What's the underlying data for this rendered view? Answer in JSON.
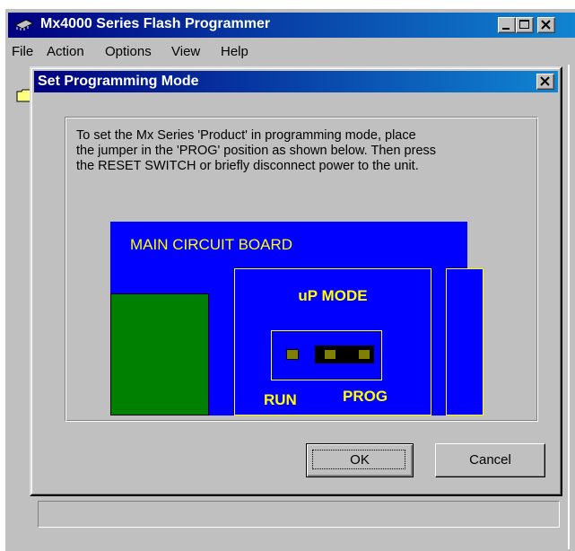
{
  "window": {
    "title": "Mx4000 Series Flash Programmer",
    "icons": {
      "app": "chip-icon",
      "minimize": "minimize-icon",
      "maximize": "maximize-icon",
      "close": "close-icon",
      "folder": "folder-icon"
    }
  },
  "menubar": {
    "items": [
      {
        "label": "File"
      },
      {
        "label": "Action"
      },
      {
        "label": "Options"
      },
      {
        "label": "View"
      },
      {
        "label": "Help"
      }
    ]
  },
  "dialog": {
    "title": "Set Programming Mode",
    "instructions": "To set the Mx Series 'Product' in programming mode, place\nthe jumper in the 'PROG' position as shown below. Then press\nthe RESET SWITCH or briefly disconnect power to the unit.",
    "board": {
      "title": "MAIN CIRCUIT BOARD",
      "mode_title": "uP MODE",
      "run_label": "RUN",
      "prog_label": "PROG",
      "jumper_position": "PROG",
      "colors": {
        "board": "#0000ff",
        "text": "#ffff00",
        "component": "#008000",
        "pin": "#808000",
        "jumper": "#000000"
      }
    },
    "buttons": {
      "ok": "OK",
      "cancel": "Cancel"
    }
  },
  "colors": {
    "title_bar": "#000080",
    "face": "#c0c0c0"
  }
}
